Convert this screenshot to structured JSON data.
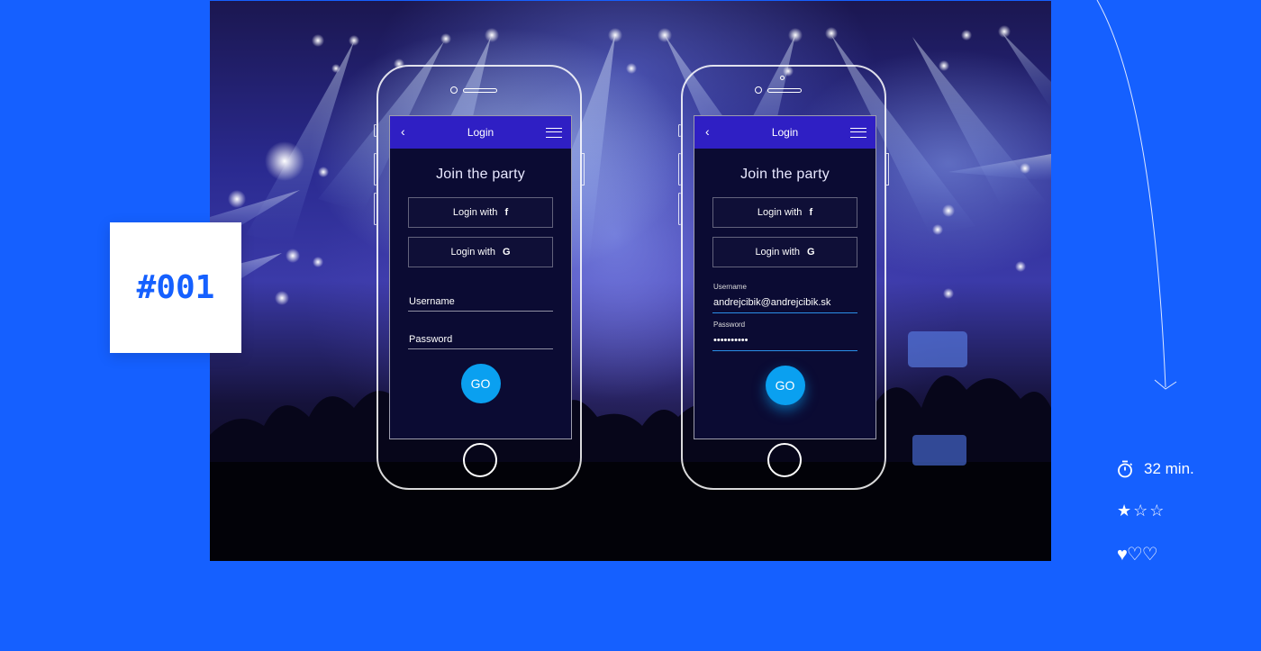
{
  "badge": {
    "number": "#001"
  },
  "screens": [
    {
      "appbar_title": "Login",
      "heading": "Join the party",
      "facebook_label": "Login with",
      "facebook_icon": "f",
      "google_label": "Login with",
      "google_icon": "G",
      "username_label": "Username",
      "password_label": "Password",
      "go_label": "GO"
    },
    {
      "appbar_title": "Login",
      "heading": "Join the party",
      "facebook_label": "Login with",
      "facebook_icon": "f",
      "google_label": "Login with",
      "google_icon": "G",
      "username_label": "Username",
      "username_value": "andrejcibik@andrejcibik.sk",
      "password_label": "Password",
      "password_value": "••••••••••",
      "go_label": "GO"
    }
  ],
  "meta": {
    "time": "32 min.",
    "difficulty_stars": "★☆☆",
    "difficulty_level": 1,
    "likes_hearts": "♥♡♡",
    "likes_level": 1
  },
  "colors": {
    "background": "#1560ff",
    "appbar": "#2f1fc4",
    "screen": "#0b0b33",
    "go_button": "#0aa0f0"
  }
}
